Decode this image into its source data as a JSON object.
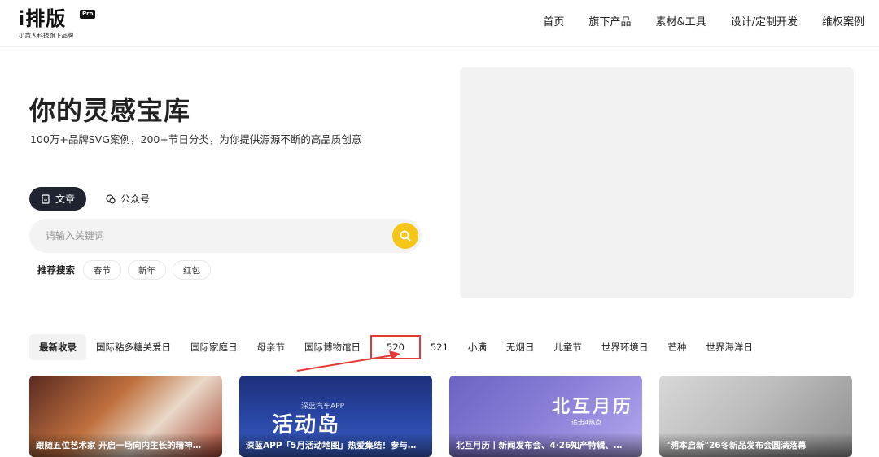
{
  "brand": {
    "name": "i排版",
    "badge": "Pro",
    "tagline": "小黄人科技旗下品牌"
  },
  "nav": {
    "items": [
      "首页",
      "旗下产品",
      "素材&工具",
      "设计/定制开发",
      "维权案例"
    ]
  },
  "hero": {
    "title": "你的灵感宝库",
    "subtitle": "100万+品牌SVG案例，200+节日分类，为你提供源源不断的高品质创意"
  },
  "search": {
    "tabs": [
      {
        "label": "文章",
        "icon": "document-icon",
        "active": true
      },
      {
        "label": "公众号",
        "icon": "wechat-icon",
        "active": false
      }
    ],
    "placeholder": "请输入关键词",
    "recommend_label": "推荐搜索",
    "recommend_tags": [
      "春节",
      "新年",
      "红包"
    ]
  },
  "categories": {
    "items": [
      "最新收录",
      "国际粘多糖关爱日",
      "国际家庭日",
      "母亲节",
      "国际博物馆日",
      "520",
      "521",
      "小满",
      "无烟日",
      "儿童节",
      "世界环境日",
      "芒种",
      "世界海洋日"
    ],
    "active": "最新收录",
    "highlighted": "520"
  },
  "cards": [
    {
      "caption": "跟随五位艺术家 开启一场向内生长的精神…"
    },
    {
      "caption": "深蓝APP「5月活动地图」热爱集结！参与…",
      "image_text": "活动岛",
      "image_sub": "深蓝汽车APP"
    },
    {
      "caption": "北互月历丨新闻发布会、4·26知产特辑、…",
      "image_text": "北互月历",
      "image_sub": "追击4热点"
    },
    {
      "caption": "\"溯本启新\"26冬新品发布会圆满落幕"
    }
  ],
  "colors": {
    "accent": "#f5c518",
    "highlight_box": "#e53935",
    "dark_tab": "#1f2430"
  }
}
